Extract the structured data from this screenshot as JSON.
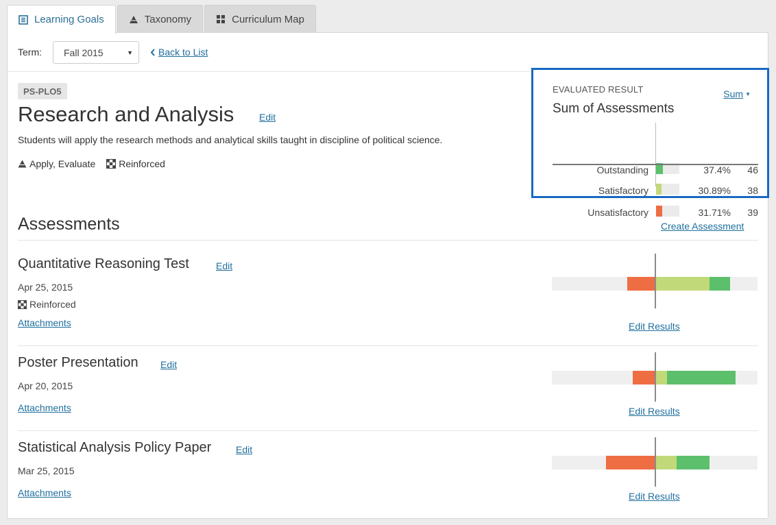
{
  "tabs": [
    {
      "label": "Learning Goals",
      "icon": "list-icon",
      "active": true
    },
    {
      "label": "Taxonomy",
      "icon": "pyramid-icon",
      "active": false
    },
    {
      "label": "Curriculum Map",
      "icon": "grid-icon",
      "active": false
    }
  ],
  "toolbar": {
    "term_label": "Term:",
    "term_value": "Fall 2015",
    "back_label": "Back to List"
  },
  "goal": {
    "code": "PS-PLO5",
    "title": "Research and Analysis",
    "edit_label": "Edit",
    "description": "Students will apply the research methods and analytical skills taught in discipline of political science.",
    "levels": "Apply, Evaluate",
    "coverage": "Reinforced"
  },
  "result": {
    "label": "EVALUATED RESULT",
    "mode": "Sum",
    "title": "Sum of Assessments",
    "rows": [
      {
        "name": "Outstanding",
        "pct": "37.4%",
        "count": "46",
        "fraction": 0.374
      },
      {
        "name": "Satisfactory",
        "pct": "30.89%",
        "count": "38",
        "fraction": 0.3089
      },
      {
        "name": "Unsatisfactory",
        "pct": "31.71%",
        "count": "39",
        "fraction": 0.3171
      }
    ]
  },
  "assessments": {
    "heading": "Assessments",
    "create_label": "Create Assessment",
    "items": [
      {
        "title": "Quantitative Reasoning Test",
        "edit_label": "Edit",
        "date": "Apr 25, 2015",
        "coverage": "Reinforced",
        "attachments_label": "Attachments",
        "edit_results_label": "Edit Results",
        "bar": {
          "unsatisfactory": 0.1333,
          "satisfactory": 0.2667,
          "outstanding": 0.1
        }
      },
      {
        "title": "Poster Presentation",
        "edit_label": "Edit",
        "date": "Apr 20, 2015",
        "attachments_label": "Attachments",
        "edit_results_label": "Edit Results",
        "bar": {
          "unsatisfactory": 0.1067,
          "satisfactory": 0.06,
          "outstanding": 0.3333
        }
      },
      {
        "title": "Statistical Analysis Policy Paper",
        "edit_label": "Edit",
        "date": "Mar 25, 2015",
        "attachments_label": "Attachments",
        "edit_results_label": "Edit Results",
        "bar": {
          "unsatisfactory": 0.2367,
          "satisfactory": 0.1067,
          "outstanding": 0.16
        }
      }
    ]
  },
  "colors": {
    "outstanding": "#5cbf6b",
    "satisfactory": "#c2d97a",
    "unsatisfactory": "#ef6d43",
    "accent": "#1769c3",
    "link": "#1f6f9e"
  }
}
